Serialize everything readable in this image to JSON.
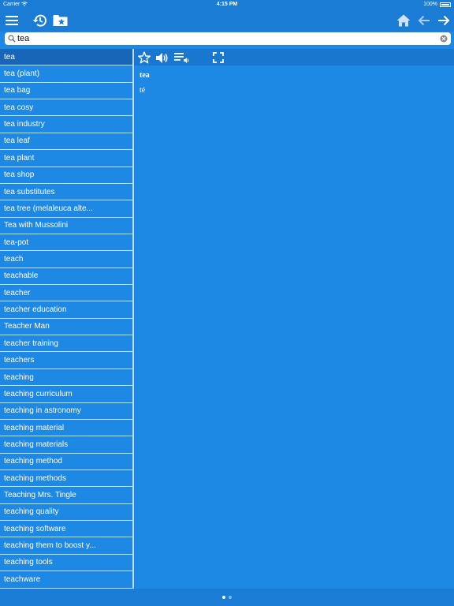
{
  "status": {
    "carrier": "Carrier",
    "time": "4:15 PM",
    "battery": "100%"
  },
  "navbar": {
    "left_icons": [
      "menu-icon",
      "history-icon",
      "bookmarks-folder-icon"
    ],
    "right_icons": [
      "home-icon",
      "arrow-left-icon",
      "arrow-right-icon"
    ]
  },
  "search": {
    "value": "tea",
    "placeholder": ""
  },
  "word_list": {
    "selected_index": 0,
    "items": [
      "tea",
      "tea (plant)",
      "tea bag",
      "tea cosy",
      "tea industry",
      "tea leaf",
      "tea plant",
      "tea shop",
      "tea substitutes",
      "tea tree (melaleuca alte...",
      "Tea with Mussolini",
      "tea-pot",
      "teach",
      "teachable",
      "teacher",
      "teacher education",
      "Teacher Man",
      "teacher training",
      "teachers",
      "teaching",
      "teaching curriculum",
      "teaching in astronomy",
      "teaching material",
      "teaching materials",
      "teaching method",
      "teaching methods",
      "Teaching Mrs. Tingle",
      "teaching quality",
      "teaching software",
      "teaching them to boost y...",
      "teaching tools",
      "teachware"
    ]
  },
  "toolbar": {
    "icons": [
      "star-icon",
      "speaker-icon",
      "playlist-audio-icon",
      "fullscreen-icon"
    ]
  },
  "entry": {
    "headword": "tea",
    "translation": "té"
  },
  "pager": {
    "pages": 2,
    "current": 1
  },
  "colors": {
    "background": "#1e88e5",
    "bar": "#1a7cd4",
    "selected": "#1766b8"
  }
}
